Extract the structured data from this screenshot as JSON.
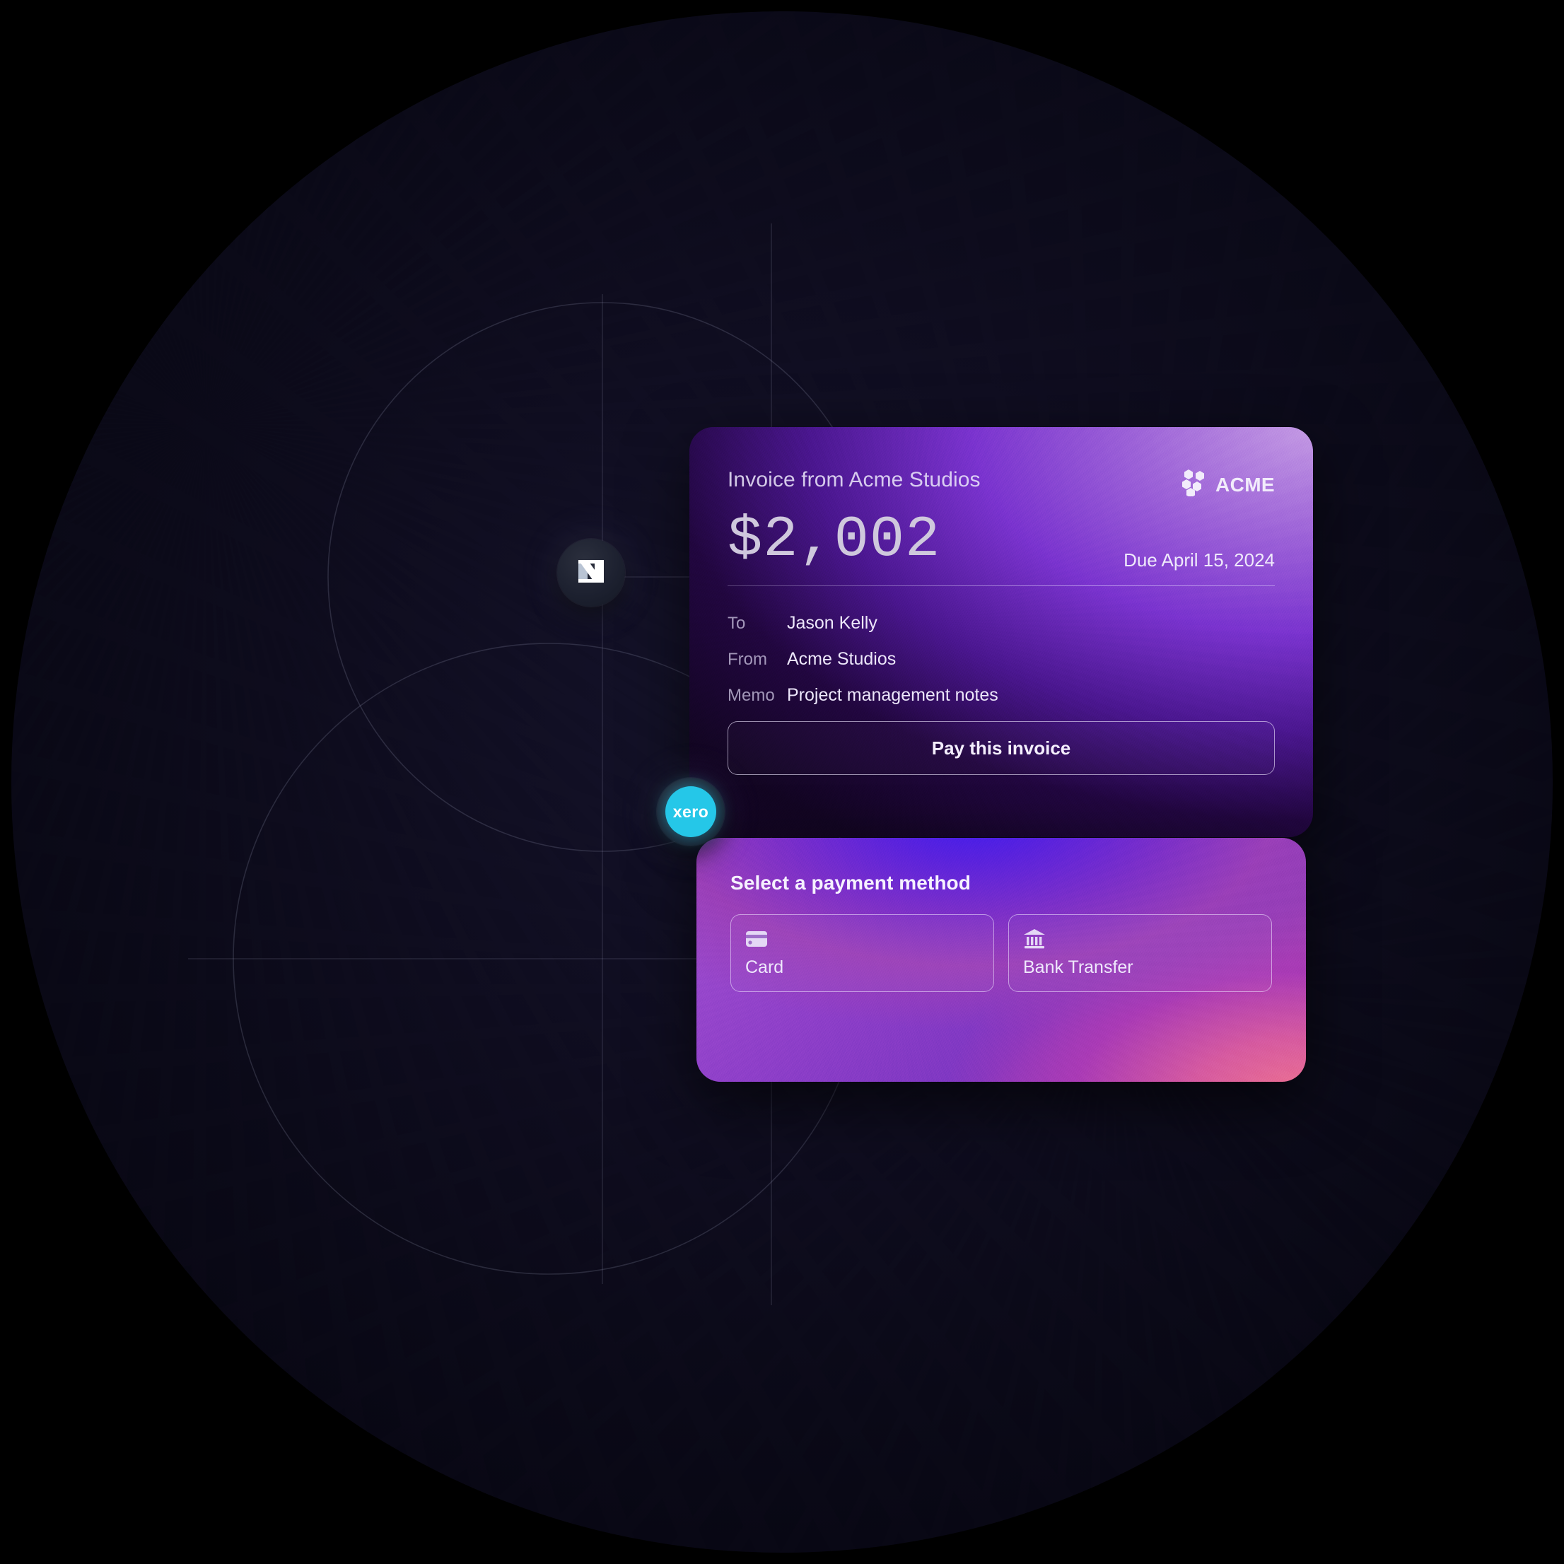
{
  "scene": {
    "background_color": "#000000",
    "disc_color": "#0e0c1e"
  },
  "badges": [
    {
      "name": "netsuite",
      "icon": "netsuite-n-logo-icon",
      "label": "NetSuite"
    },
    {
      "name": "xero",
      "icon": "xero-logo-icon",
      "label": "xero",
      "brand_color": "#25c7e8"
    }
  ],
  "invoice_card": {
    "title": "Invoice from Acme Studios",
    "brand": {
      "name": "ACME",
      "logo_icon": "acme-hexagon-cluster-icon"
    },
    "amount": "$2,002",
    "due": "Due April 15, 2024",
    "fields": [
      {
        "label": "To",
        "value": "Jason Kelly"
      },
      {
        "label": "From",
        "value": "Acme Studios"
      },
      {
        "label": "Memo",
        "value": "Project management notes"
      }
    ],
    "pay_button_label": "Pay this invoice",
    "accent_color": "#7a33cf"
  },
  "payment_card": {
    "heading": "Select a payment method",
    "methods": [
      {
        "label": "Card",
        "icon": "credit-card-icon"
      },
      {
        "label": "Bank Transfer",
        "icon": "bank-building-icon"
      }
    ],
    "accent_color": "#5a22dd"
  }
}
